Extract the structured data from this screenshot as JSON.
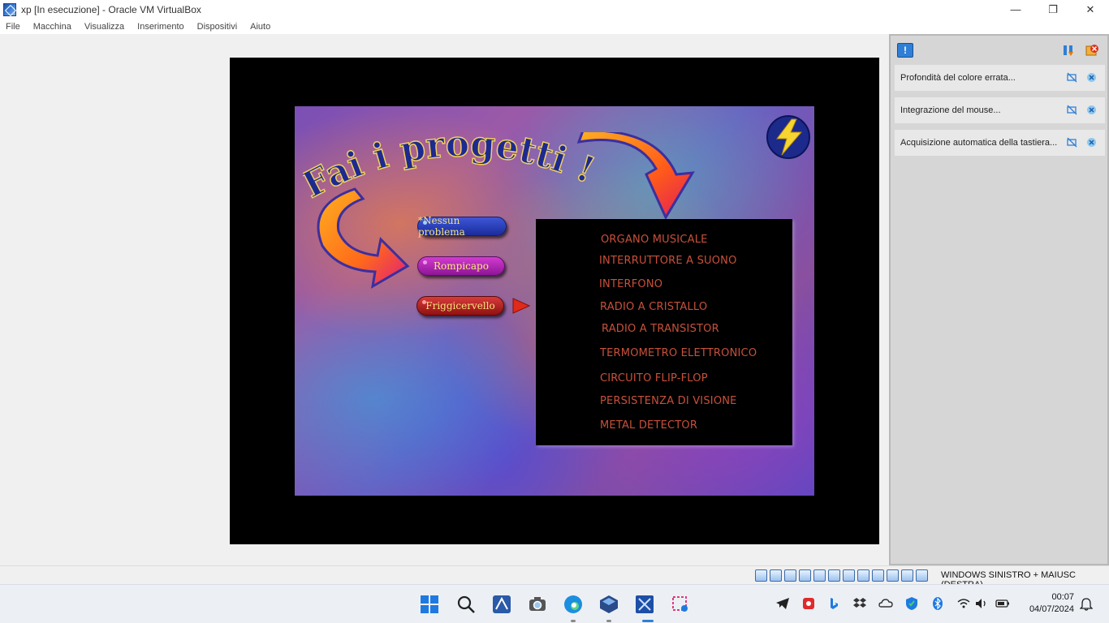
{
  "window": {
    "title": "xp [In esecuzione] - Oracle VM VirtualBox",
    "minimize": "—",
    "restore": "❐",
    "close": "✕"
  },
  "menu": [
    "File",
    "Macchina",
    "Visualizza",
    "Inserimento",
    "Dispositivi",
    "Aiuto"
  ],
  "game": {
    "title": "Fai i progetti !",
    "buttons": [
      "*Nessun problema",
      "Rompicapo",
      "Friggicervello"
    ],
    "projects": [
      "ORGANO MUSICALE",
      "INTERRUTTORE A SUONO",
      "INTERFONO",
      "RADIO A CRISTALLO",
      "RADIO A TRANSISTOR",
      "TERMOMETRO ELETTRONICO",
      "CIRCUITO FLIP-FLOP",
      "PERSISTENZA DI VISIONE",
      "METAL DETECTOR"
    ]
  },
  "notifications": {
    "header_icon": "!",
    "items": [
      "Profondità del colore errata...",
      "Integrazione del mouse...",
      "Acquisizione automatica della tastiera..."
    ]
  },
  "statusbar": {
    "host_key": "WINDOWS SINISTRO + MAIUSC (DESTRA)"
  },
  "taskbar": {
    "time": "00:07",
    "date": "04/07/2024"
  },
  "colors": {
    "project_text": "#c8503a",
    "accent_blue": "#2f7fd6",
    "button_text": "#f6e27a"
  }
}
